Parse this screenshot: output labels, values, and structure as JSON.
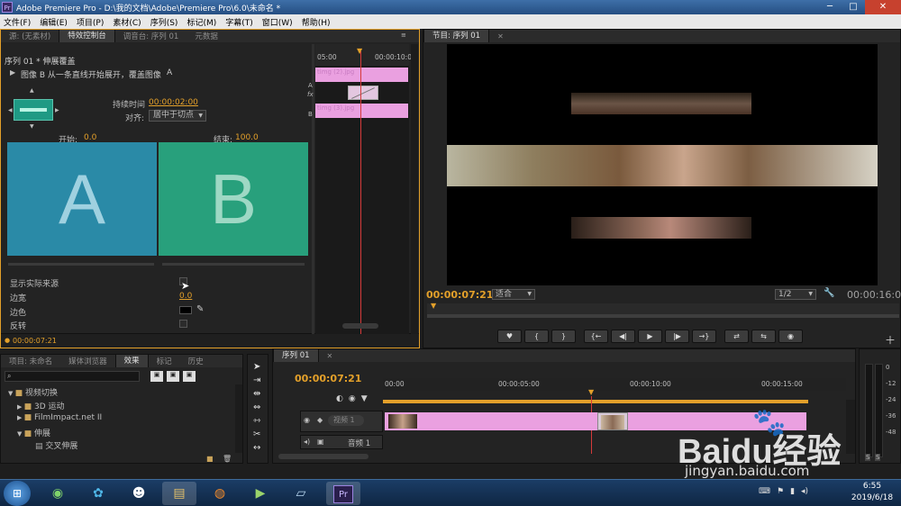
{
  "window": {
    "title": "Adobe Premiere Pro - D:\\我的文档\\Adobe\\Premiere Pro\\6.0\\未命名 *",
    "min": "─",
    "max": "□",
    "close": "✕"
  },
  "menu": [
    "文件(F)",
    "编辑(E)",
    "项目(P)",
    "素材(C)",
    "序列(S)",
    "标记(M)",
    "字幕(T)",
    "窗口(W)",
    "帮助(H)"
  ],
  "effect_panel": {
    "tabs": [
      "源: (无素材)",
      "特效控制台",
      "调音台: 序列 01",
      "元数据"
    ],
    "sequence_label": "序列 01 * 伸展覆盖",
    "description": "图像 B 从一条直线开始展开，覆盖图像",
    "duration_label": "持续时间",
    "duration_value": "00:00:02:00",
    "align_label": "对齐:",
    "align_value": "居中于切点",
    "start_label": "开始:",
    "start_value": "0.0",
    "end_label": "结束:",
    "end_value": "100.0",
    "a_letter": "A",
    "b_letter": "B",
    "show_source": "显示实际来源",
    "border_width_label": "边宽",
    "border_width_value": "0.0",
    "border_color_label": "边色",
    "reverse_label": "反转",
    "footer_time": "00:00:07:21",
    "mini_timeline": {
      "ruler_start": "05:00",
      "ruler_end": "00:00:10:0",
      "track_a": "A",
      "track_b": "B",
      "clip_a": "timg (2).jpg",
      "clip_b": "timg (3).jpg"
    }
  },
  "program_monitor": {
    "tab": "节目: 序列 01",
    "current_time": "00:00:07:21",
    "fit": "适合",
    "quality": "1/2",
    "duration": "00:00:16:00",
    "buttons": [
      "♥",
      "{",
      "}",
      "{←",
      "◀|",
      "▶",
      "|▶",
      "→}",
      "⇄",
      "⇆",
      "◉"
    ]
  },
  "project_panel": {
    "tabs": [
      "项目: 未命名",
      "媒体浏览器",
      "效果",
      "标记",
      "历史"
    ],
    "tree": [
      {
        "label": "视频切换",
        "level": 0,
        "icon": "folder-icon"
      },
      {
        "label": "3D 运动",
        "level": 1,
        "icon": "folder-icon"
      },
      {
        "label": "FilmImpact.net II",
        "level": 1,
        "icon": "folder-icon"
      },
      {
        "label": "伸展",
        "level": 1,
        "icon": "folder-icon"
      },
      {
        "label": "交叉伸展",
        "level": 2,
        "icon": "effect-icon"
      }
    ]
  },
  "timeline": {
    "tab": "序列 01",
    "current_time": "00:00:07:21",
    "ruler": [
      "00:00",
      "00:00:05:00",
      "00:00:10:00",
      "00:00:15:00"
    ],
    "video_track": "视频 1",
    "audio_track": "音频 1"
  },
  "meters": {
    "scale": [
      "0",
      "-12",
      "-24",
      "-36",
      "-48"
    ],
    "solo": "S"
  },
  "taskbar": {
    "time": "6:55",
    "date": "2019/6/18",
    "pr": "Pr"
  },
  "watermark": {
    "brand": "Baidu经验",
    "url": "jingyan.baidu.com"
  },
  "colors": {
    "accent": "#e3a02a",
    "clip": "#eaa0e0",
    "a_tile": "#2a8aa7",
    "b_tile": "#28a07c",
    "playhead": "#d63a3a"
  }
}
